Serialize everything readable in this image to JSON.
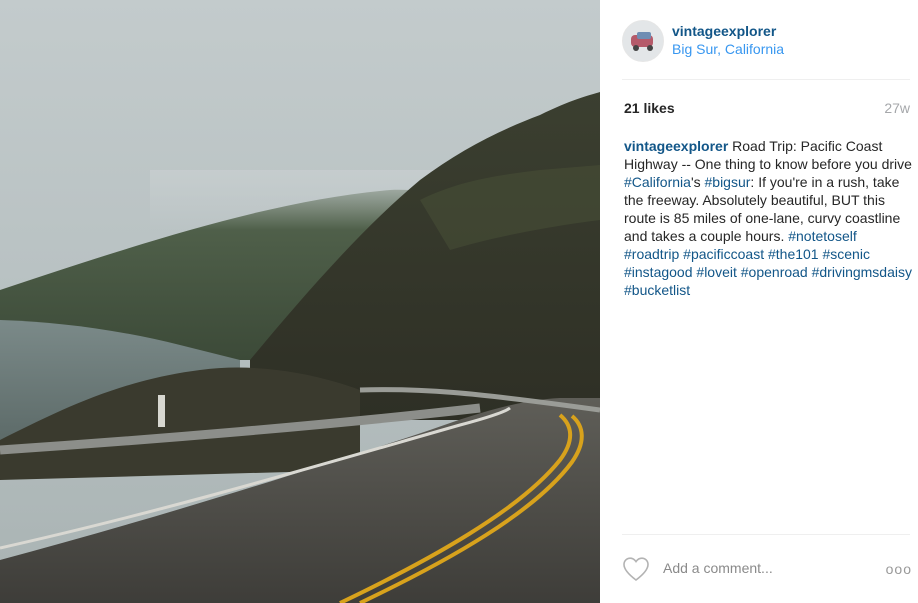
{
  "post": {
    "username": "vintageexplorer",
    "location": "Big Sur, California",
    "likes": "21 likes",
    "time": "27w",
    "caption": {
      "user": "vintageexplorer",
      "text_1": " Road Trip: Pacific Coast Highway -- One thing to know before you drive ",
      "tag_california": "#California",
      "text_2": "'s ",
      "tag_bigsur": "#bigsur",
      "text_3": ": If you're in a rush, take the freeway. Absolutely beautiful, BUT this route is 85 miles of one-lane, curvy coastline and takes a couple hours. ",
      "hashtags": [
        "#notetoself",
        "#roadtrip",
        "#pacificcoast",
        "#the101",
        "#scenic",
        "#instagood",
        "#loveit",
        "#openroad",
        "#drivingmsdaisy",
        "#bucketlist"
      ]
    },
    "comment_placeholder": "Add a comment...",
    "more_label": "ooo"
  },
  "icons": {
    "like": "heart-icon",
    "more": "more-options-icon"
  },
  "colors": {
    "username": "#125688",
    "location": "#3897f0",
    "muted": "#a5a7aa"
  }
}
